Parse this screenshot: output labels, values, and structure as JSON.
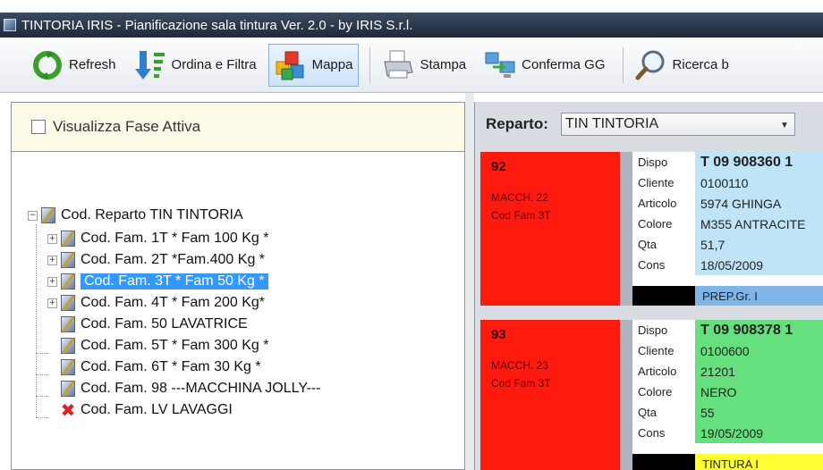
{
  "window": {
    "title": "TINTORIA IRIS  -  Pianificazione sala tintura   Ver. 2.0  - by IRIS S.r.l."
  },
  "toolbar": {
    "buttons": [
      {
        "label": "Refresh",
        "icon": "refresh-icon"
      },
      {
        "label": "Ordina e Filtra",
        "icon": "sort-filter-icon"
      },
      {
        "label": "Mappa",
        "icon": "map-icon"
      },
      {
        "label": "Stampa",
        "icon": "printer-icon"
      },
      {
        "label": "Conferma GG",
        "icon": "confirm-icon"
      },
      {
        "label": "Ricerca b",
        "icon": "search-icon"
      }
    ]
  },
  "left": {
    "checkbox_label": "Visualizza Fase Attiva",
    "tree": {
      "root": "Cod. Reparto TIN TINTORIA",
      "items": [
        {
          "label": "Cod. Fam. 1T * Fam 100 Kg *",
          "expandable": true
        },
        {
          "label": "Cod. Fam. 2T *Fam.400 Kg *",
          "expandable": true
        },
        {
          "label": "Cod. Fam. 3T * Fam 50 Kg *",
          "expandable": true,
          "selected": true
        },
        {
          "label": "Cod. Fam. 4T * Fam 200 Kg*",
          "expandable": true
        },
        {
          "label": "Cod. Fam. 50 LAVATRICE",
          "expandable": false
        },
        {
          "label": "Cod. Fam. 5T * Fam 300 Kg  *",
          "expandable": false
        },
        {
          "label": "Cod. Fam. 6T * Fam 30 Kg *",
          "expandable": false
        },
        {
          "label": "Cod. Fam. 98 ---MACCHINA JOLLY---",
          "expandable": false
        },
        {
          "label": "Cod. Fam. LV LAVAGGI",
          "expandable": false,
          "icon": "x-icon"
        }
      ]
    }
  },
  "right": {
    "reparto_label": "Reparto:",
    "reparto_value": "TIN  TINTORIA",
    "cards": [
      {
        "number": "92",
        "machine": "MACCH. 22",
        "family": "Cod Fam 3T",
        "dispo_label": "Dispo",
        "dispo": "T 09 908360 1",
        "cliente_label": "Cliente",
        "cliente": "0100110",
        "articolo_label": "Articolo",
        "articolo": "5974 GHINGA",
        "colore_label": "Colore",
        "colore": "M355 ANTRACITE",
        "qta_label": "Qta",
        "qta": "51,7",
        "cons_label": "Cons",
        "cons": "18/05/2009",
        "status": "PREP.Gr. I",
        "color_panel": "#bfe3f7",
        "color_status": "#7fb4e6"
      },
      {
        "number": "93",
        "machine": "MACCH. 23",
        "family": "Cod Fam 3T",
        "dispo_label": "Dispo",
        "dispo": "T 09 908378 1",
        "cliente_label": "Cliente",
        "cliente": "0100600",
        "articolo_label": "Articolo",
        "articolo": "21201",
        "colore_label": "Colore",
        "colore": "NERO",
        "qta_label": "Qta",
        "qta": "55",
        "cons_label": "Cons",
        "cons": "19/05/2009",
        "status": "TINTURA I",
        "color_panel": "#66e07f",
        "color_status": "#ffff33"
      }
    ]
  }
}
